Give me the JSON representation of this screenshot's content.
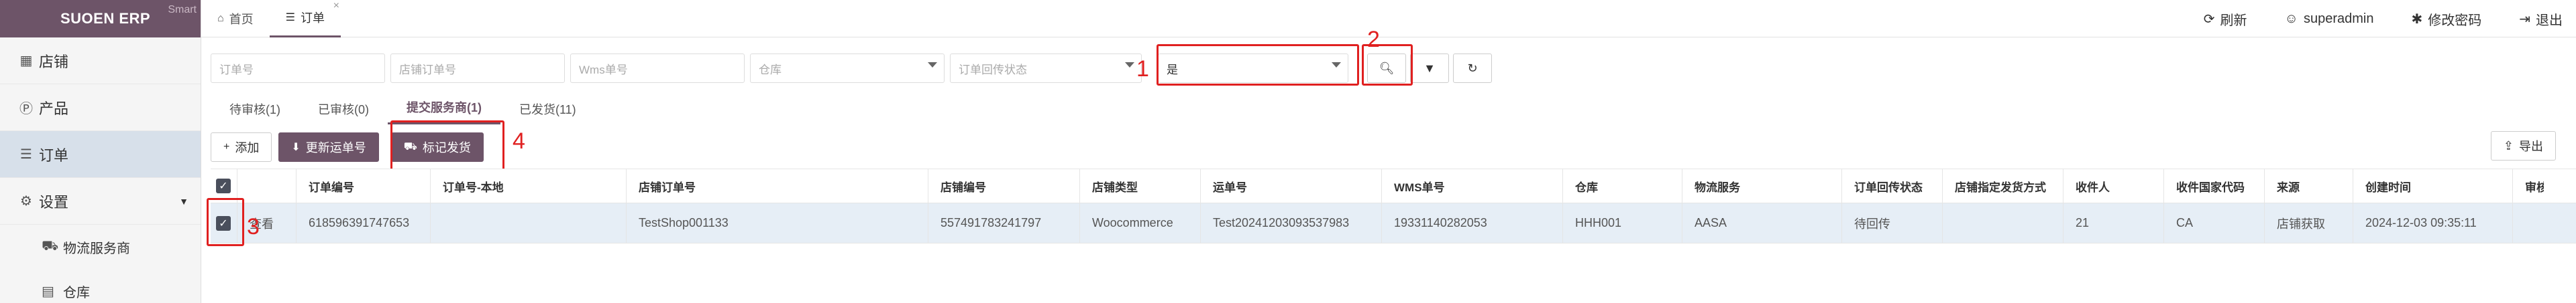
{
  "brand": {
    "title": "SUOEN ERP",
    "badge": "Smart"
  },
  "sidebar": {
    "items": [
      {
        "icon": "store-icon",
        "glyph": "▦",
        "label": "店铺"
      },
      {
        "icon": "product-icon",
        "glyph": "Ⓟ",
        "label": "产品"
      },
      {
        "icon": "order-list-icon",
        "glyph": "☰",
        "label": "订单"
      },
      {
        "icon": "gear-icon",
        "glyph": "⚙",
        "label": "设置"
      }
    ],
    "sub_items": [
      {
        "icon": "truck-icon",
        "glyph": "⛟",
        "label": "物流服务商"
      },
      {
        "icon": "warehouse-icon",
        "glyph": "▤",
        "label": "仓库"
      }
    ]
  },
  "tabs": [
    {
      "icon": "home-icon",
      "glyph": "⌂",
      "label": "首页"
    },
    {
      "icon": "list-icon",
      "glyph": "☰",
      "label": "订单",
      "close": "×"
    }
  ],
  "top_right": {
    "refresh": "刷新",
    "user": "superadmin",
    "change_password": "修改密码",
    "logout": "退出"
  },
  "filters": {
    "order_no": "订单号",
    "store_order_no": "店铺订单号",
    "wms_no": "Wms单号",
    "warehouse": "仓库",
    "return_status": "订单回传状态",
    "selected_value": "是"
  },
  "annotations": [
    "1",
    "2",
    "3",
    "4"
  ],
  "status_tabs": [
    {
      "label": "待审核(1)"
    },
    {
      "label": "已审核(0)"
    },
    {
      "label": "提交服务商(1)"
    },
    {
      "label": "已发货(11)"
    }
  ],
  "actions": {
    "add": "添加",
    "update_tracking": "更新运单号",
    "mark_shipped": "标记发货",
    "export": "导出"
  },
  "table": {
    "columns": [
      "订单编号",
      "订单号-本地",
      "店铺订单号",
      "店铺编号",
      "店铺类型",
      "运单号",
      "WMS单号",
      "仓库",
      "物流服务",
      "订单回传状态",
      "店铺指定发货方式",
      "收件人",
      "收件国家代码",
      "来源",
      "创建时间",
      "审核"
    ],
    "rows": [
      {
        "view": "查看",
        "cells": [
          "618596391747653",
          "",
          "TestShop001133",
          "557491783241797",
          "Woocommerce",
          "Test20241203093537983",
          "19331140282053",
          "HHH001",
          "AASA",
          "待回传",
          "",
          "21",
          "CA",
          "店铺获取",
          "2024-12-03 09:35:11",
          ""
        ]
      }
    ]
  },
  "colors": {
    "brand": "#6d5468",
    "highlight": "#e02020",
    "selected_row": "#e6eef6"
  }
}
